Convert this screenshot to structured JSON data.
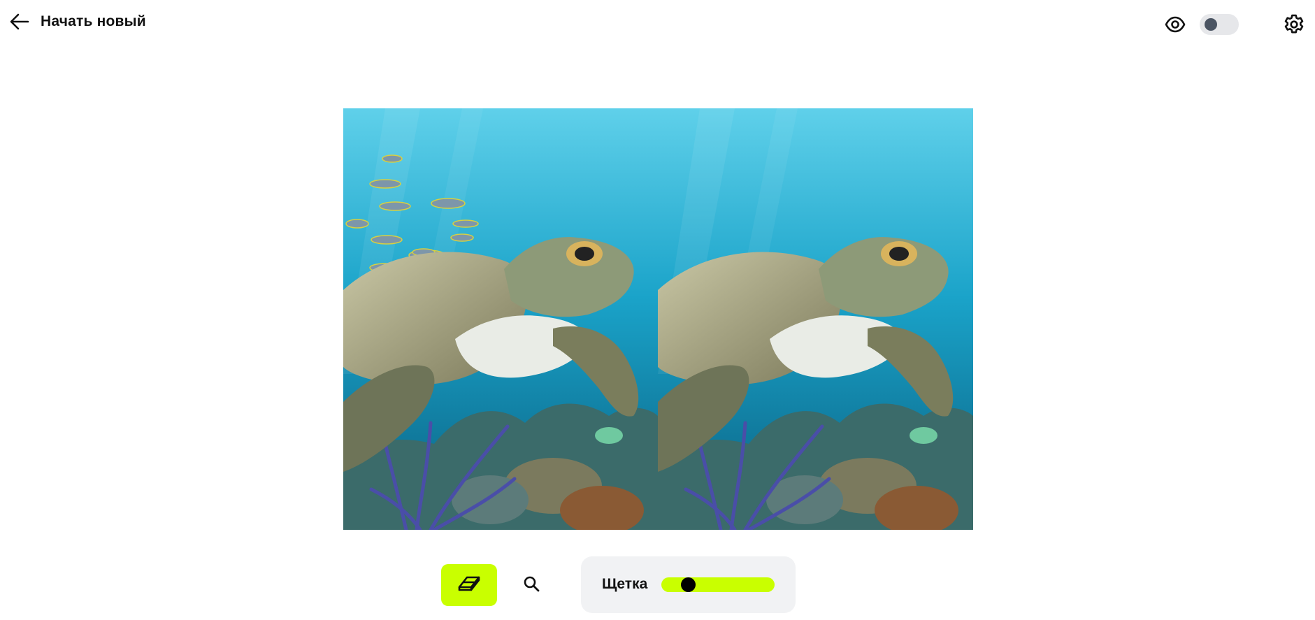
{
  "header": {
    "back_label": "Начать новый",
    "back_icon": "arrow-left-icon",
    "preview_icon": "eye-icon",
    "toggle_on": false,
    "settings_icon": "gear-icon"
  },
  "viewer": {
    "images": [
      {
        "role": "original",
        "subject": "sea turtle with school of fish over coral reef"
      },
      {
        "role": "result",
        "subject": "sea turtle over coral reef, fish removed"
      }
    ]
  },
  "toolbar": {
    "eraser_icon": "eraser-icon",
    "zoom_icon": "search-icon",
    "brush_label": "Щетка",
    "brush_size_fraction": 0.2
  },
  "colors": {
    "accent": "#c9ff00",
    "toggle_track": "#e6e7ea",
    "toggle_knob": "#4b5563",
    "panel_bg": "#f1f2f4"
  }
}
